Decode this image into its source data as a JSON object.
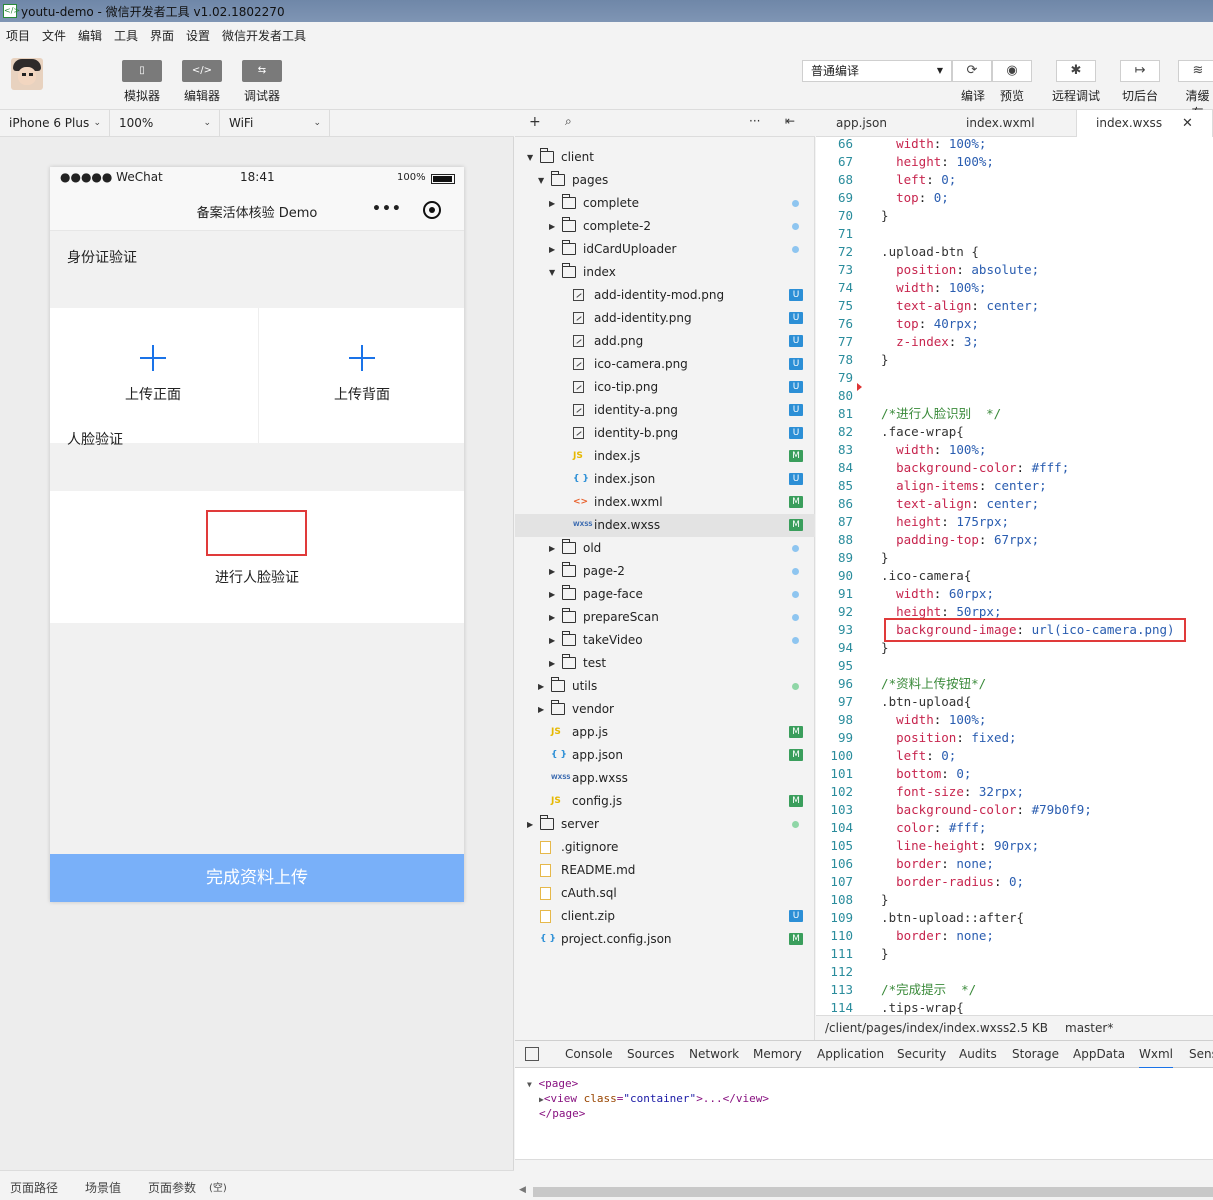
{
  "window": {
    "title": "youtu-demo - 微信开发者工具 v1.02.1802270"
  },
  "menu": [
    "项目",
    "文件",
    "编辑",
    "工具",
    "界面",
    "设置",
    "微信开发者工具"
  ],
  "toolbar": {
    "simulator": "模拟器",
    "editor": "编辑器",
    "debugger": "调试器",
    "compile_mode": "普通编译",
    "compile": "编译",
    "preview": "预览",
    "remote_debug": "远程调试",
    "background": "切后台",
    "clear_cache": "清缓存"
  },
  "device": {
    "model": "iPhone 6 Plus",
    "zoom": "100%",
    "network": "WiFi"
  },
  "phone": {
    "carrier": "●●●●● WeChat",
    "time": "18:41",
    "battery": "100%",
    "nav_title": "备案活体核验 Demo",
    "id_section": "身份证验证",
    "upload_front": "上传正面",
    "upload_back": "上传背面",
    "face_section": "人脸验证",
    "face_action": "进行人脸验证",
    "submit": "完成资料上传"
  },
  "bottombar": {
    "path": "页面路径",
    "scene": "场景值",
    "params": "页面参数"
  },
  "tree": [
    {
      "d": 0,
      "type": "folder-open",
      "name": "client",
      "arrow": "down"
    },
    {
      "d": 1,
      "type": "folder-open",
      "name": "pages",
      "arrow": "down"
    },
    {
      "d": 2,
      "type": "folder",
      "name": "complete",
      "arrow": "right",
      "status": "blue"
    },
    {
      "d": 2,
      "type": "folder",
      "name": "complete-2",
      "arrow": "right",
      "status": "blue"
    },
    {
      "d": 2,
      "type": "folder",
      "name": "idCardUploader",
      "arrow": "right",
      "status": "blue"
    },
    {
      "d": 2,
      "type": "folder-open",
      "name": "index",
      "arrow": "down"
    },
    {
      "d": 3,
      "type": "img",
      "name": "add-identity-mod.png",
      "badge": "U"
    },
    {
      "d": 3,
      "type": "img",
      "name": "add-identity.png",
      "badge": "U"
    },
    {
      "d": 3,
      "type": "img",
      "name": "add.png",
      "badge": "U"
    },
    {
      "d": 3,
      "type": "img",
      "name": "ico-camera.png",
      "badge": "U"
    },
    {
      "d": 3,
      "type": "img",
      "name": "ico-tip.png",
      "badge": "U"
    },
    {
      "d": 3,
      "type": "img",
      "name": "identity-a.png",
      "badge": "U"
    },
    {
      "d": 3,
      "type": "img",
      "name": "identity-b.png",
      "badge": "U"
    },
    {
      "d": 3,
      "type": "js",
      "name": "index.js",
      "badge": "M"
    },
    {
      "d": 3,
      "type": "json",
      "name": "index.json",
      "badge": "U"
    },
    {
      "d": 3,
      "type": "wxml",
      "name": "index.wxml",
      "badge": "M"
    },
    {
      "d": 3,
      "type": "wxss",
      "name": "index.wxss",
      "badge": "M",
      "selected": true
    },
    {
      "d": 2,
      "type": "folder",
      "name": "old",
      "arrow": "right",
      "status": "blue"
    },
    {
      "d": 2,
      "type": "folder",
      "name": "page-2",
      "arrow": "right",
      "status": "blue"
    },
    {
      "d": 2,
      "type": "folder",
      "name": "page-face",
      "arrow": "right",
      "status": "blue"
    },
    {
      "d": 2,
      "type": "folder",
      "name": "prepareScan",
      "arrow": "right",
      "status": "blue"
    },
    {
      "d": 2,
      "type": "folder",
      "name": "takeVideo",
      "arrow": "right",
      "status": "blue"
    },
    {
      "d": 2,
      "type": "folder",
      "name": "test",
      "arrow": "right"
    },
    {
      "d": 1,
      "type": "folder",
      "name": "utils",
      "arrow": "right",
      "status": "green"
    },
    {
      "d": 1,
      "type": "folder",
      "name": "vendor",
      "arrow": "right"
    },
    {
      "d": 1,
      "type": "js",
      "name": "app.js",
      "badge": "M"
    },
    {
      "d": 1,
      "type": "json",
      "name": "app.json",
      "badge": "M"
    },
    {
      "d": 1,
      "type": "wxss",
      "name": "app.wxss"
    },
    {
      "d": 1,
      "type": "js",
      "name": "config.js",
      "badge": "M"
    },
    {
      "d": 0,
      "type": "folder",
      "name": "server",
      "arrow": "right",
      "status": "green"
    },
    {
      "d": 0,
      "type": "txt",
      "name": ".gitignore"
    },
    {
      "d": 0,
      "type": "txt",
      "name": "README.md"
    },
    {
      "d": 0,
      "type": "txt",
      "name": "cAuth.sql"
    },
    {
      "d": 0,
      "type": "txt",
      "name": "client.zip",
      "badge": "U"
    },
    {
      "d": 0,
      "type": "json",
      "name": "project.config.json",
      "badge": "M"
    }
  ],
  "tabs": [
    "app.json",
    "index.wxml",
    "index.wxss"
  ],
  "code_lines": [
    [
      "66",
      "    width: 100%;"
    ],
    [
      "67",
      "    height: 100%;"
    ],
    [
      "68",
      "    left: 0;"
    ],
    [
      "69",
      "    top: 0;"
    ],
    [
      "70",
      "  }"
    ],
    [
      "71",
      ""
    ],
    [
      "72",
      "  .upload-btn {"
    ],
    [
      "73",
      "    position: absolute;"
    ],
    [
      "74",
      "    width: 100%;"
    ],
    [
      "75",
      "    text-align: center;"
    ],
    [
      "76",
      "    top: 40rpx;"
    ],
    [
      "77",
      "    z-index: 3;"
    ],
    [
      "78",
      "  }"
    ],
    [
      "79",
      ""
    ],
    [
      "80",
      ""
    ],
    [
      "81",
      "  /*进行人脸识别  */"
    ],
    [
      "82",
      "  .face-wrap{"
    ],
    [
      "83",
      "    width: 100%;"
    ],
    [
      "84",
      "    background-color: #fff;"
    ],
    [
      "85",
      "    align-items: center;"
    ],
    [
      "86",
      "    text-align: center;"
    ],
    [
      "87",
      "    height: 175rpx;"
    ],
    [
      "88",
      "    padding-top: 67rpx;"
    ],
    [
      "89",
      "  }"
    ],
    [
      "90",
      "  .ico-camera{"
    ],
    [
      "91",
      "    width: 60rpx;"
    ],
    [
      "92",
      "    height: 50rpx;"
    ],
    [
      "93",
      "    background-image: url(ico-camera.png)"
    ],
    [
      "94",
      "  }"
    ],
    [
      "95",
      ""
    ],
    [
      "96",
      "  /*资料上传按钮*/"
    ],
    [
      "97",
      "  .btn-upload{"
    ],
    [
      "98",
      "    width: 100%;"
    ],
    [
      "99",
      "    position: fixed;"
    ],
    [
      "100",
      "    left: 0;"
    ],
    [
      "101",
      "    bottom: 0;"
    ],
    [
      "102",
      "    font-size: 32rpx;"
    ],
    [
      "103",
      "    background-color: #79b0f9;"
    ],
    [
      "104",
      "    color: #fff;"
    ],
    [
      "105",
      "    line-height: 90rpx;"
    ],
    [
      "106",
      "    border: none;"
    ],
    [
      "107",
      "    border-radius: 0;"
    ],
    [
      "108",
      "  }"
    ],
    [
      "109",
      "  .btn-upload::after{"
    ],
    [
      "110",
      "    border: none;"
    ],
    [
      "111",
      "  }"
    ],
    [
      "112",
      ""
    ],
    [
      "113",
      "  /*完成提示  */"
    ],
    [
      "114",
      "  .tips-wrap{"
    ]
  ],
  "editor_status": {
    "path": "/client/pages/index/index.wxss",
    "size": "2.5 KB",
    "branch": "master*"
  },
  "devtools_tabs": [
    "Console",
    "Sources",
    "Network",
    "Memory",
    "Application",
    "Security",
    "Audits",
    "Storage",
    "AppData",
    "Wxml",
    "Sens"
  ],
  "wxml": {
    "open": "<page>",
    "view": "<view class=\"container\">...</view>",
    "close": "</page>"
  },
  "colors": {
    "accent": "#1a73e8",
    "submit_button": "#79b0f9",
    "highlight": "#e03a3a"
  }
}
